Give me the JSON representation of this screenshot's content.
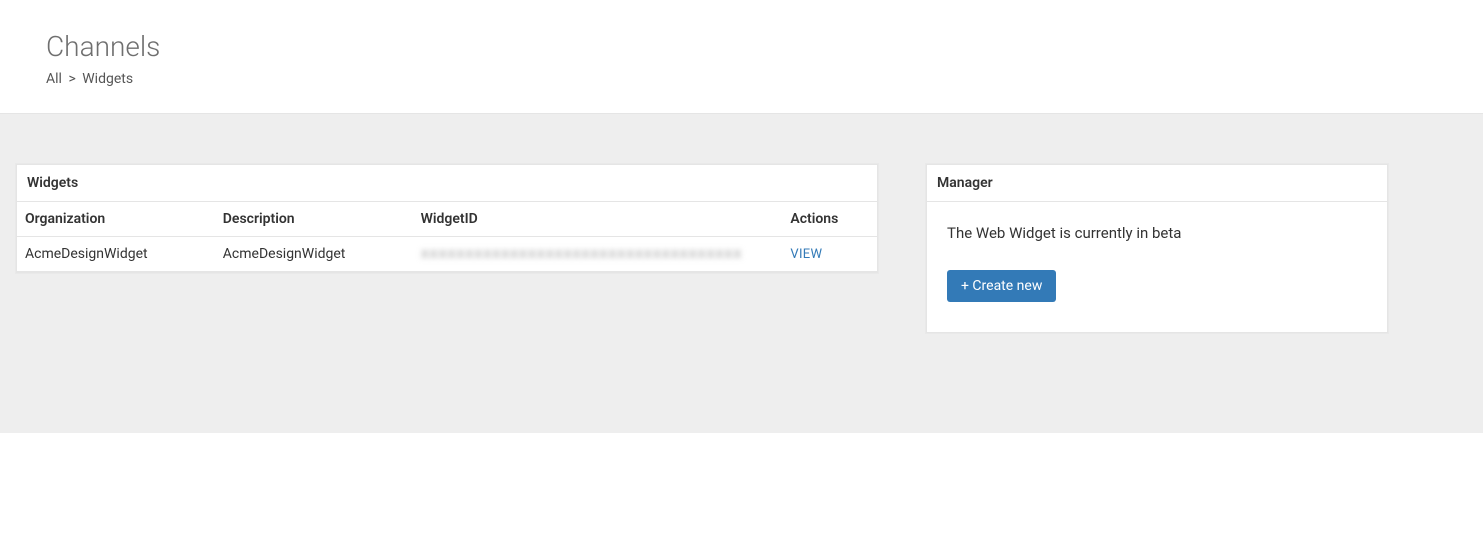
{
  "header": {
    "title": "Channels",
    "breadcrumb": {
      "root": "All",
      "sep": ">",
      "current": "Widgets"
    }
  },
  "widgetsPanel": {
    "title": "Widgets",
    "columns": {
      "organization": "Organization",
      "description": "Description",
      "widgetId": "WidgetID",
      "actions": "Actions"
    },
    "rows": [
      {
        "organization": "AcmeDesignWidget",
        "description": "AcmeDesignWidget",
        "widgetId": "xxxxxxxxxxxxxxxxxxxxxxxxxxxxxxxxxxxx",
        "action": "VIEW"
      }
    ]
  },
  "managerPanel": {
    "title": "Manager",
    "message": "The Web Widget is currently in beta",
    "createButton": "+ Create new"
  }
}
